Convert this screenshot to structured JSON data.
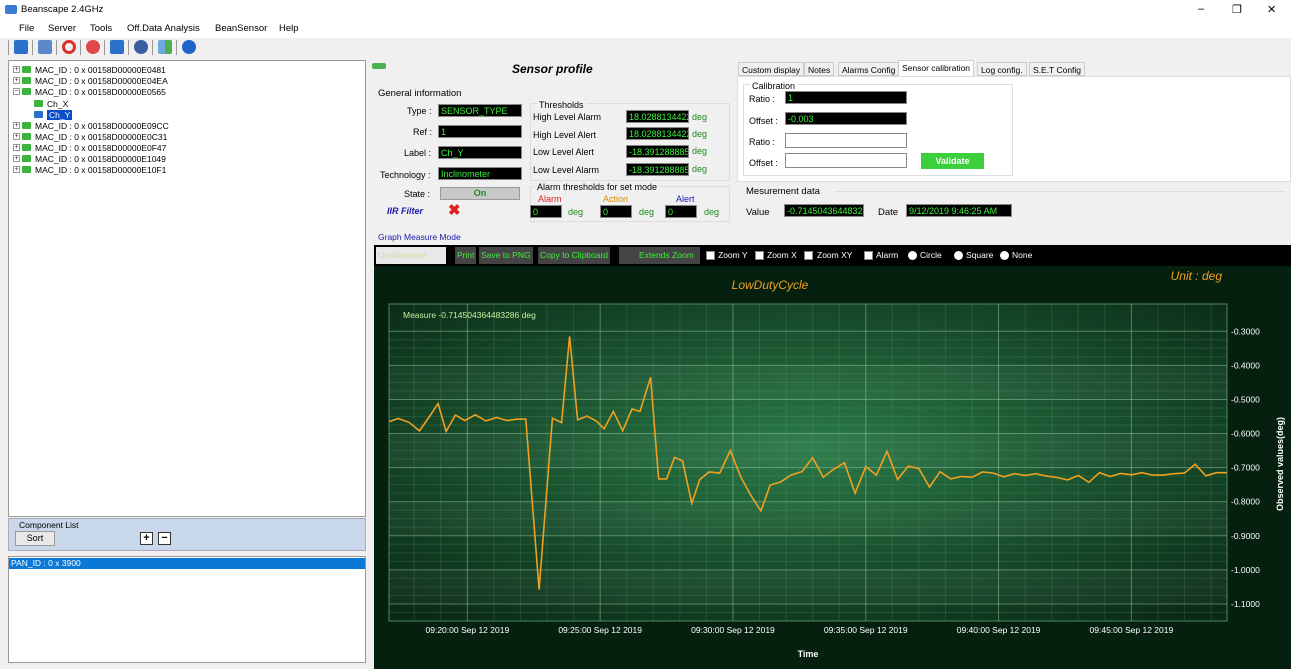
{
  "window": {
    "title": "Beanscape 2.4GHz",
    "minimize": "–",
    "restore": "❐",
    "close": "✕"
  },
  "menu": [
    "File",
    "Server",
    "Tools",
    "Off.Data Analysis",
    "BeanSensor",
    "Help"
  ],
  "tree": {
    "items": [
      {
        "label": "MAC_ID : 0 x 00158D00000E0481",
        "exp": "+"
      },
      {
        "label": "MAC_ID : 0 x 00158D00000E04EA",
        "exp": "+"
      },
      {
        "label": "MAC_ID : 0 x 00158D00000E0565",
        "exp": "−"
      },
      {
        "label": "Ch_X"
      },
      {
        "label": "Ch_Y"
      },
      {
        "label": "MAC_ID : 0 x 00158D00000E09CC",
        "exp": "+"
      },
      {
        "label": "MAC_ID : 0 x 00158D00000E0C31",
        "exp": "+"
      },
      {
        "label": "MAC_ID : 0 x 00158D00000E0F47",
        "exp": "+"
      },
      {
        "label": "MAC_ID : 0 x 00158D00000E1049",
        "exp": "+"
      },
      {
        "label": "MAC_ID : 0 x 00158D00000E10F1",
        "exp": "+"
      }
    ]
  },
  "component": {
    "title": "Component List",
    "sort": "Sort",
    "plus": "+",
    "minus": "−"
  },
  "pan": {
    "item": "PAN_ID : 0 x 3900"
  },
  "profile": {
    "title": "Sensor profile",
    "general": "General information",
    "type_label": "Type :",
    "type": "SENSOR_TYPE",
    "ref_label": "Ref :",
    "ref": "1",
    "label_label": "Label :",
    "label": "Ch_Y",
    "tech_label": "Technology :",
    "tech": "Inclinometer",
    "state_label": "State :",
    "state": "On",
    "iir": "IIR Filter",
    "thresholds": "Thresholds",
    "thr": [
      {
        "name": "High Level Alarm",
        "value": "18.0288134422",
        "unit": "deg"
      },
      {
        "name": "High Level Alert",
        "value": "18.0288134422",
        "unit": "deg"
      },
      {
        "name": "Low Level Alert",
        "value": "-18.3912888857",
        "unit": "deg"
      },
      {
        "name": "Low Level Alarm",
        "value": "-18.3912888857",
        "unit": "deg"
      }
    ],
    "set_mode": "Alarm thresholds for set mode",
    "alarm": "Alarm",
    "action": "Action",
    "alert": "Alert",
    "alarm_v": "0",
    "action_v": "0",
    "alert_v": "0",
    "deg": "deg"
  },
  "tabs": [
    "Custom display",
    "Notes",
    "Alarms Config",
    "Sensor calibration",
    "Log config.",
    "S.E.T Config"
  ],
  "calib": {
    "title": "Calibration",
    "ratio": "Ratio :",
    "ratio_v": "1",
    "offset": "Offset :",
    "offset_v": "-0.003",
    "ratio2": "Ratio :",
    "offset2": "Offset :",
    "validate": "Validate"
  },
  "mesure": {
    "title": "Mesurement data",
    "value_label": "Value",
    "value": "-0.714504364483286",
    "date_label": "Date",
    "date": "9/12/2019 9:46:25 AM"
  },
  "graph_mode": "Graph Measure Mode",
  "gtoolbar": {
    "scope": "Oscilloscope",
    "print": "Print",
    "save": "Save to PNG",
    "copy": "Copy to Clipboard",
    "extends": "Extends Zoom",
    "zy": "Zoom Y",
    "zx": "Zoom X",
    "zxy": "Zoom XY",
    "alarm": "Alarm",
    "circle": "Circle",
    "square": "Square",
    "none": "None"
  },
  "chart_data": {
    "type": "line",
    "title": "LowDutyCycle",
    "unit_label": "Unit : deg",
    "annotation": "Measure  -0.714504364483286  deg",
    "xlabel": "Time",
    "ylabel": "Observed values(deg)",
    "xticks": [
      "09:20:00 Sep 12 2019",
      "09:25:00 Sep 12 2019",
      "09:30:00 Sep 12 2019",
      "09:35:00 Sep 12 2019",
      "09:40:00 Sep 12 2019",
      "09:45:00 Sep 12 2019"
    ],
    "yticks": [
      "-0.3000",
      "-0.4000",
      "-0.5000",
      "-0.6000",
      "-0.7000",
      "-0.8000",
      "-0.9000",
      "-1.0000",
      "-1.1000"
    ],
    "ylim": [
      -1.15,
      -0.22
    ],
    "x_minutes_range": [
      17.05,
      48.6
    ],
    "series": [
      {
        "color": "#f0a020",
        "x": [
          17.05,
          17.4,
          17.8,
          18.2,
          18.55,
          18.9,
          19.2,
          19.55,
          19.9,
          20.3,
          20.7,
          21.1,
          21.5,
          21.85,
          22.2,
          22.7,
          23.2,
          23.55,
          23.85,
          24.15,
          24.5,
          24.85,
          25.15,
          25.5,
          25.85,
          26.2,
          26.5,
          26.9,
          27.2,
          27.5,
          27.8,
          28.1,
          28.45,
          28.75,
          29.1,
          29.5,
          29.9,
          30.3,
          30.7,
          31.05,
          31.4,
          31.8,
          32.2,
          32.6,
          33.0,
          33.4,
          33.8,
          34.2,
          34.6,
          35.0,
          35.4,
          35.8,
          36.2,
          36.6,
          37.0,
          37.4,
          37.8,
          38.2,
          38.6,
          39.0,
          39.4,
          39.8,
          40.2,
          40.6,
          41.0,
          41.4,
          41.8,
          42.2,
          42.6,
          43.0,
          43.4,
          43.8,
          44.2,
          44.6,
          45.0,
          45.4,
          45.8,
          46.2,
          46.6,
          47.0,
          47.4,
          47.8,
          48.2,
          48.6
        ],
        "y": [
          -0.565,
          -0.556,
          -0.567,
          -0.592,
          -0.553,
          -0.512,
          -0.594,
          -0.546,
          -0.562,
          -0.545,
          -0.563,
          -0.553,
          -0.562,
          -0.558,
          -0.558,
          -1.058,
          -0.555,
          -0.568,
          -0.315,
          -0.56,
          -0.549,
          -0.563,
          -0.586,
          -0.535,
          -0.592,
          -0.528,
          -0.535,
          -0.435,
          -0.733,
          -0.733,
          -0.67,
          -0.68,
          -0.805,
          -0.735,
          -0.713,
          -0.716,
          -0.65,
          -0.728,
          -0.785,
          -0.827,
          -0.751,
          -0.742,
          -0.721,
          -0.712,
          -0.671,
          -0.728,
          -0.704,
          -0.686,
          -0.775,
          -0.697,
          -0.722,
          -0.652,
          -0.735,
          -0.696,
          -0.703,
          -0.757,
          -0.712,
          -0.733,
          -0.726,
          -0.728,
          -0.713,
          -0.716,
          -0.727,
          -0.718,
          -0.723,
          -0.718,
          -0.725,
          -0.729,
          -0.736,
          -0.723,
          -0.743,
          -0.715,
          -0.726,
          -0.717,
          -0.721,
          -0.715,
          -0.722,
          -0.722,
          -0.718,
          -0.716,
          -0.69,
          -0.724,
          -0.715,
          -0.715
        ]
      }
    ]
  }
}
